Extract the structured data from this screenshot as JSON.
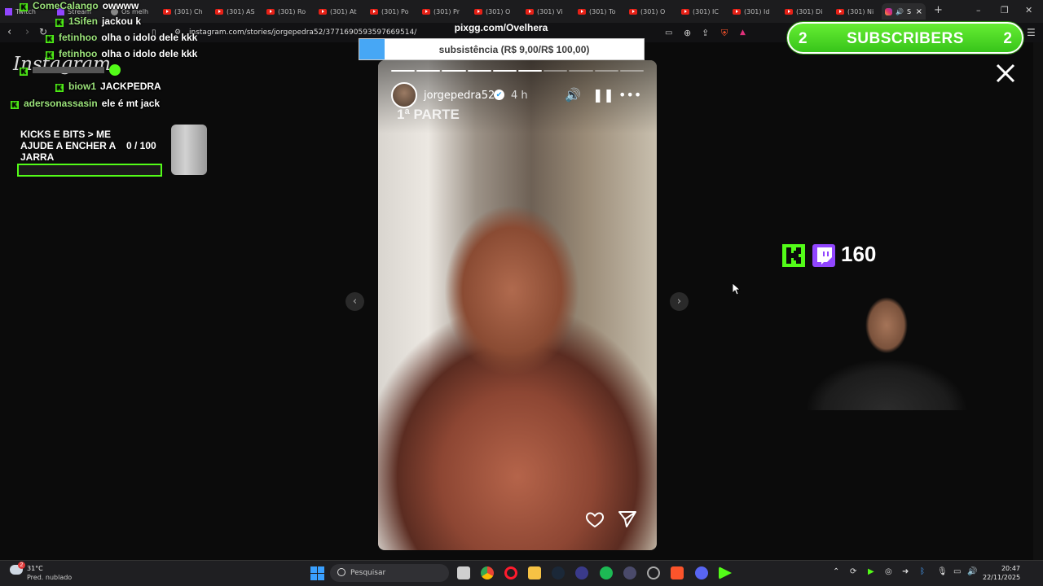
{
  "browser": {
    "tabs": [
      {
        "label": "Twitch",
        "icon": "twitch-icon"
      },
      {
        "label": "Stream",
        "icon": "twitch-icon"
      },
      {
        "label": "Os melh",
        "icon": "page-icon"
      },
      {
        "label": "(301) Ch",
        "icon": "youtube-icon"
      },
      {
        "label": "(301) AS",
        "icon": "youtube-icon"
      },
      {
        "label": "(301) Ro",
        "icon": "youtube-icon"
      },
      {
        "label": "(301) At",
        "icon": "youtube-icon"
      },
      {
        "label": "(301) Po",
        "icon": "youtube-icon"
      },
      {
        "label": "(301) Pr",
        "icon": "youtube-icon"
      },
      {
        "label": "(301) O",
        "icon": "youtube-icon"
      },
      {
        "label": "(301) Vi",
        "icon": "youtube-icon"
      },
      {
        "label": "(301) To",
        "icon": "youtube-icon"
      },
      {
        "label": "(301) O",
        "icon": "youtube-icon"
      },
      {
        "label": "(301) IC",
        "icon": "youtube-icon"
      },
      {
        "label": "(301) Id",
        "icon": "youtube-icon"
      },
      {
        "label": "(301) Di",
        "icon": "youtube-icon"
      },
      {
        "label": "(301) Ni",
        "icon": "youtube-icon"
      },
      {
        "label": "S",
        "icon": "instagram-icon"
      }
    ],
    "url": "instagram.com/stories/jorgepedra52/3771690593597669514/"
  },
  "page": {
    "logo": "Instagram"
  },
  "story": {
    "username": "jorgepedra52",
    "time": "4 h",
    "overlay_text": "1ª PARTE",
    "segments_total": 10,
    "segments_done": 6
  },
  "overlays": {
    "pix_title": "pixgg.com/Ovelhera",
    "pix_goal": "subsistência (R$ 9,00/R$ 100,00)",
    "pix_progress": 0.09,
    "subs_left": "2",
    "subs_label": "SUBSCRIBERS",
    "subs_right": "2",
    "viewer_count": "160",
    "goal_text": "KICKS E BITS > ME AJUDE A ENCHER A JARRA",
    "goal_count": "0   / 100"
  },
  "chat": [
    {
      "nick": "ComeCalango",
      "msg": "owwww"
    },
    {
      "nick": "1Sifen",
      "msg": "jackou k"
    },
    {
      "nick": "fetinhoo",
      "msg": "olha o idolo dele kkk"
    },
    {
      "nick": "fetinhoo",
      "msg": "olha o idolo dele kkk"
    },
    {
      "nick": "biow1",
      "msg": "JACKPEDRA"
    },
    {
      "nick": "adersonassasin",
      "msg": "ele é mt jack"
    }
  ],
  "taskbar": {
    "temp": "31°C",
    "weather": "Pred. nublado",
    "search": "Pesquisar",
    "time": "20:47",
    "date": "22/11/2025",
    "weather_badge": "2"
  },
  "colors": {
    "kick_green": "#53fc18",
    "twitch_purple": "#9146ff",
    "pix_blue": "#47a7f5"
  }
}
